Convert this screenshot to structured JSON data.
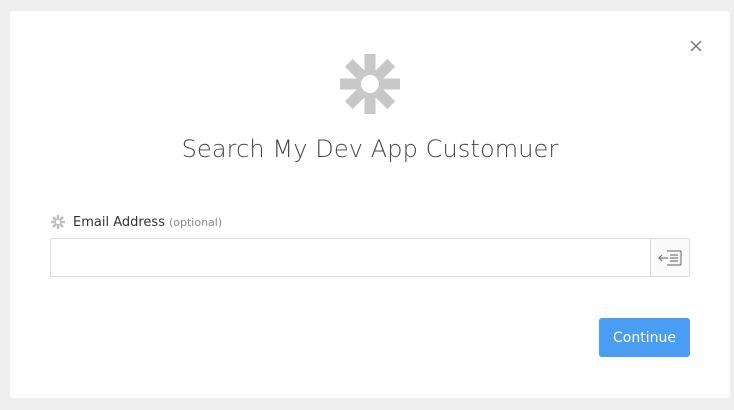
{
  "modal": {
    "title": "Search My Dev App Customuer",
    "logo_icon": "snowflake-asterisk-icon",
    "close_icon": "close-icon"
  },
  "field": {
    "label": "Email Address",
    "optional": "(optional)",
    "label_icon": "gear-asterisk-icon",
    "value": "",
    "placeholder": "",
    "insert_icon": "insert-data-icon"
  },
  "actions": {
    "continue_label": "Continue"
  },
  "colors": {
    "accent": "#499df3",
    "logo": "#c8c8c8",
    "background": "#eeeeee"
  }
}
